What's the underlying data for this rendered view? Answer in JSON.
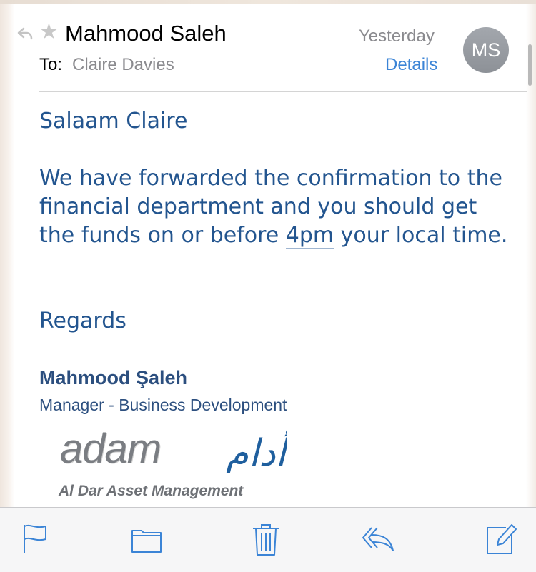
{
  "header": {
    "sender": "Mahmood Saleh",
    "to_label": "To:",
    "to_name": "Claire Davies",
    "date": "Yesterday",
    "details_label": "Details",
    "avatar_initials": "MS"
  },
  "body": {
    "greeting": "Salaam Claire",
    "para_before_time": "We have forwarded the confirmation to the financial department and you should get the funds on or before ",
    "time_link": "4pm",
    "para_after_time": " your local time.",
    "closing": "Regards"
  },
  "signature": {
    "name": "Mahmood Şaleh",
    "title": "Manager - Business Development"
  },
  "logo": {
    "latin": "adam",
    "arabic": "أدام",
    "subtitle": "Al Dar Asset Management"
  },
  "toolbar": {
    "icons": [
      "flag-icon",
      "folder-icon",
      "trash-icon",
      "reply-icon",
      "compose-icon"
    ],
    "accent_color": "#3b84d6"
  },
  "colors": {
    "body_text": "#23558f",
    "signature": "#2c4f7f",
    "link": "#3b84d6"
  }
}
